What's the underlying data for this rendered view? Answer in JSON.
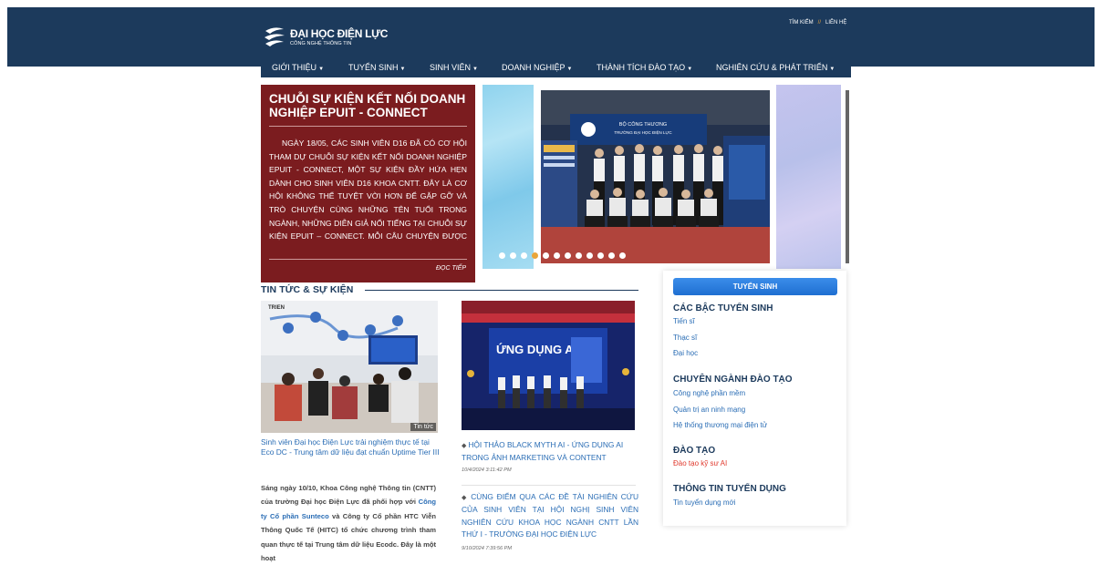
{
  "header": {
    "logo_main": "ĐẠI HỌC ĐIỆN LỰC",
    "logo_sub": "CÔNG NGHỆ THÔNG TIN",
    "link_search": "TÌM KIẾM",
    "separator": "//",
    "link_contact": "LIÊN HỆ"
  },
  "nav": {
    "items": [
      {
        "label": "GIỚI THIỆU"
      },
      {
        "label": "TUYỂN SINH"
      },
      {
        "label": "SINH VIÊN"
      },
      {
        "label": "DOANH NGHIỆP"
      },
      {
        "label": "THÀNH TÍCH ĐÀO TẠO"
      },
      {
        "label": "NGHIÊN CỨU & PHÁT TRIỂN"
      }
    ]
  },
  "hero": {
    "title": "CHUỖI SỰ KIỆN KẾT NỐI DOANH NGHIỆP EPUIT - CONNECT",
    "body": "NGÀY 18/05, CÁC SINH VIÊN D16 ĐÃ CÓ CƠ HỘI THAM DỰ CHUỖI SỰ KIỆN KẾT NỐI DOANH NGHIỆP EPUIT - CONNECT, MỘT SỰ KIỆN ĐẦY HỨA HẸN DÀNH CHO SINH VIÊN D16 KHOA CNTT. ĐÂY LÀ CƠ HỘI KHÔNG THỂ TUYỆT VỜI HƠN ĐỂ GẶP GỠ VÀ TRÒ CHUYỆN CÙNG NHỮNG TÊN TUỔI TRONG NGÀNH, NHỮNG DIỄN GIẢ NỔI TIẾNG TẠI CHUỖI SỰ KIỆN EPUIT – CONNECT. MỖI CÂU CHUYỆN ĐƯỢC CHIA SẺ, MỖI BÀI HỌC KINH",
    "read_more": "ĐỌC TIẾP",
    "photo_banner_line1": "BỘ CÔNG THƯƠNG",
    "photo_banner_line2": "TRƯỜNG ĐẠI HỌC ĐIỆN LỰC",
    "slides_total": 12,
    "slide_active": 4
  },
  "section": {
    "title": "TIN TỨC & SỰ KIỆN"
  },
  "news": {
    "item1": {
      "tag": "Tin tức",
      "title": "Sinh viên Đại học Điện Lực trải nghiệm thực tế tại Eco DC - Trung tâm dữ liệu đạt chuẩn Uptime Tier III",
      "body_a": "Sáng ngày 10/10, Khoa Công nghệ Thông tin (CNTT) của trường Đại học Điện Lực đã phối hợp với ",
      "body_hl": "Công ty Cổ phần Sunteco",
      "body_b": " và Công ty Cổ phần HTC Viễn Thông Quốc Tế (HITC) tổ chức chương trình tham quan thực tế tại Trung tâm dữ liệu Ecodc. Đây là một hoạt",
      "img_label": "TRIEN"
    },
    "item2": {
      "title": "HỘI THẢO BLACK MYTH AI - ỨNG DỤNG AI TRONG ẢNH MARKETING VÀ CONTENT",
      "date": "10/4/2024 3:11:42 PM",
      "img_label": "ỨNG DỤNG AI"
    },
    "item3": {
      "title": "CÙNG ĐIỂM QUA CÁC ĐỀ TÀI NGHIÊN CỨU CỦA SINH VIÊN TẠI HỘI NGHỊ SINH VIÊN NGHIÊN CỨU KHOA HỌC NGÀNH CNTT LẦN THỨ I - TRƯỜNG ĐẠI HỌC ĐIỆN LỰC",
      "date": "9/10/2024 7:39:56 PM"
    }
  },
  "sidebar": {
    "button": "TUYỂN SINH",
    "h1": "CÁC BẬC TUYỂN SINH",
    "l1": [
      "Tiến sĩ",
      "Thạc sĩ",
      "Đại học"
    ],
    "h2": "CHUYÊN NGÀNH ĐÀO TẠO",
    "l2": [
      "Công nghệ phần mềm",
      "Quản trị an ninh mạng",
      "Hệ thống thương mại điện tử"
    ],
    "h3": "ĐÀO TẠO",
    "l3": [
      "Đào tạo kỹ sư AI"
    ],
    "h4": "THÔNG TIN TUYỂN DỤNG",
    "l4": [
      "Tin tuyển dụng mới"
    ]
  }
}
